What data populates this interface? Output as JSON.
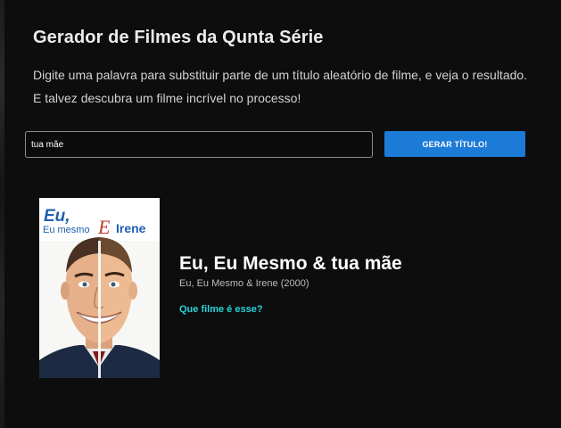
{
  "header": {
    "title": "Gerador de Filmes da Qunta Série",
    "description_line1": "Digite uma palavra para substituir parte de um título aleatório de filme, e veja o resultado.",
    "description_line2": "E talvez descubra um filme incrível no processo!"
  },
  "form": {
    "input_value": "tua mãe",
    "button_label": "GERAR TÍTULO!"
  },
  "result": {
    "generated_title": "Eu, Eu Mesmo & tua mãe",
    "original_title": "Eu, Eu Mesmo & Irene (2000)",
    "link_label": "Que filme é esse?",
    "poster": {
      "line1": "Eu,",
      "line2_a": "Eu mesmo",
      "line2_e": "E",
      "line2_b": "Irene"
    }
  },
  "colors": {
    "background": "#0d0d0e",
    "button": "#1c7bd6",
    "link": "#27d3d8",
    "poster_title": "#1f5fb0",
    "poster_e": "#c0392b"
  }
}
